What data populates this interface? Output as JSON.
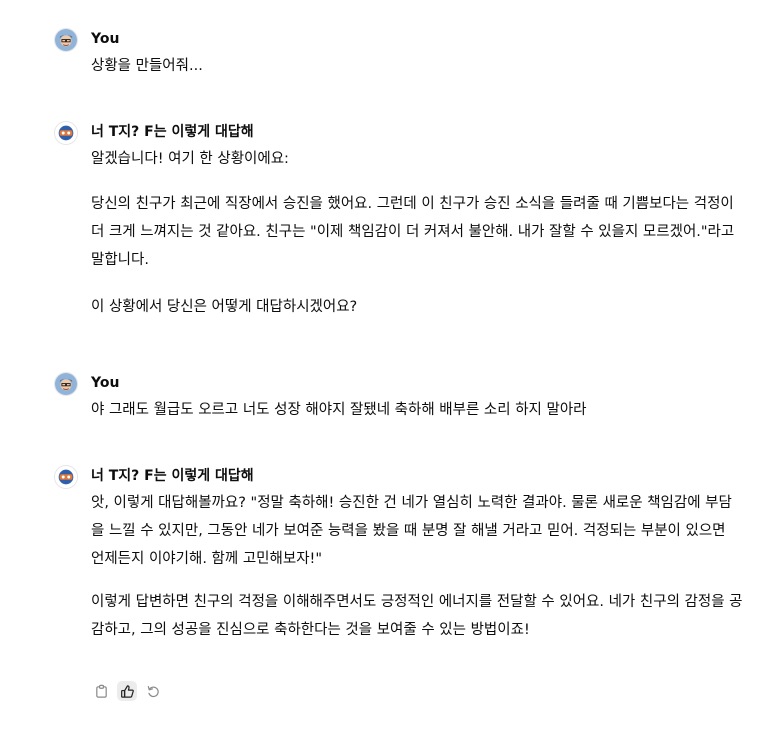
{
  "messages": [
    {
      "author": "You",
      "paragraphs": [
        "상황을 만들어줘..."
      ]
    },
    {
      "author": "너 T지? F는 이렇게 대답해",
      "paragraphs": [
        "알겠습니다! 여기 한 상황이에요:",
        "당신의 친구가 최근에 직장에서 승진을 했어요. 그런데 이 친구가 승진 소식을 들려줄 때 기쁨보다는 걱정이 더 크게 느껴지는 것 같아요. 친구는 \"이제 책임감이 더 커져서 불안해. 내가 잘할 수 있을지 모르겠어.\"라고 말합니다.",
        "이 상황에서 당신은 어떻게 대답하시겠어요?"
      ]
    },
    {
      "author": "You",
      "paragraphs": [
        "야 그래도 월급도 오르고 너도 성장 해야지 잘됐네 축하해 배부른 소리 하지 말아라"
      ]
    },
    {
      "author": "너 T지? F는 이렇게 대답해",
      "paragraphs": [
        "앗, 이렇게 대답해볼까요? \"정말 축하해! 승진한 건 네가 열심히 노력한 결과야. 물론 새로운 책임감에 부담을 느낄 수 있지만, 그동안 네가 보여준 능력을 봤을 때 분명 잘 해낼 거라고 믿어. 걱정되는 부분이 있으면 언제든지 이야기해. 함께 고민해보자!\"",
        "이렇게 답변하면 친구의 걱정을 이해해주면서도 긍정적인 에너지를 전달할 수 있어요. 네가 친구의 감정을 공감하고, 그의 성공을 진심으로 축하한다는 것을 보여줄 수 있는 방법이죠!"
      ]
    }
  ],
  "actions": [
    "copy-icon",
    "thumbs-up-icon",
    "regenerate-icon"
  ]
}
